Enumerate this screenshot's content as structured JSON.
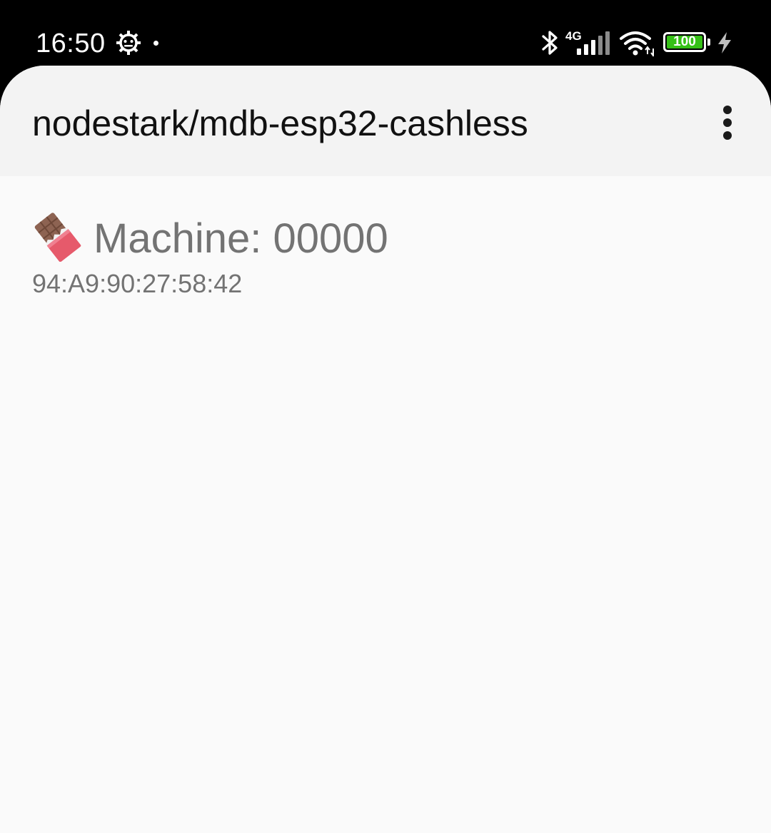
{
  "status_bar": {
    "time": "16:50",
    "network_type": "4G",
    "battery_level": "100",
    "battery_fraction": 1.0,
    "battery_color": "#35c016",
    "icons": [
      "gear-icon",
      "notification-dot",
      "bluetooth-icon",
      "signal-icon",
      "wifi-icon",
      "battery-icon",
      "charging-icon"
    ]
  },
  "app_bar": {
    "title": "nodestark/mdb-esp32-cashless",
    "menu_icon": "more-vert-icon"
  },
  "machines": [
    {
      "icon": "chocolate-bar-icon",
      "name": "Machine: 00000",
      "address": "94:A9:90:27:58:42"
    }
  ]
}
